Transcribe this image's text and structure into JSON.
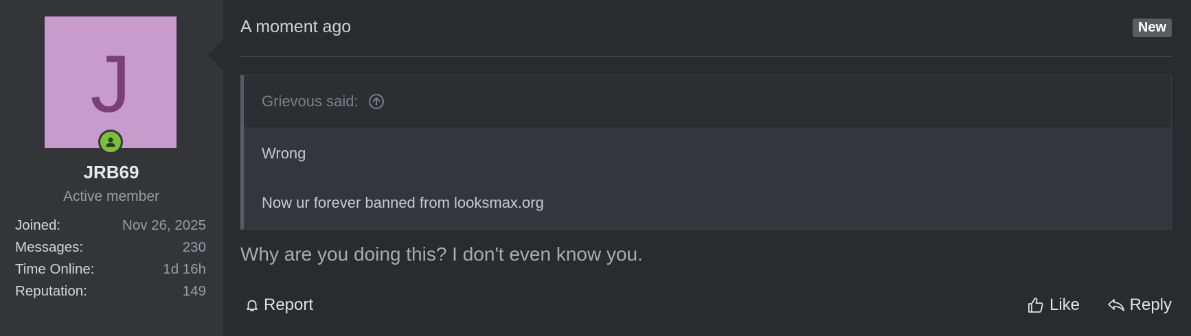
{
  "user": {
    "avatar_letter": "J",
    "avatar_color": "#c79bcc",
    "status_icon": "online-user-icon",
    "status_color": "#7cbf3b",
    "username": "JRB69",
    "title": "Active member",
    "stats": [
      {
        "label": "Joined:",
        "value": "Nov 26, 2025"
      },
      {
        "label": "Messages:",
        "value": "230"
      },
      {
        "label": "Time Online:",
        "value": "1d 16h"
      },
      {
        "label": "Reputation:",
        "value": "149"
      }
    ]
  },
  "post": {
    "time": "A moment ago",
    "badge": "New",
    "quote": {
      "author_line": "Grievous said:",
      "jump_icon": "arrow-up-circle-icon",
      "lines": [
        "Wrong",
        "Now ur forever banned from looksmax.org"
      ]
    },
    "message": "Why are you doing this? I don't even know you.",
    "actions": {
      "report": "Report",
      "like": "Like",
      "reply": "Reply"
    }
  }
}
